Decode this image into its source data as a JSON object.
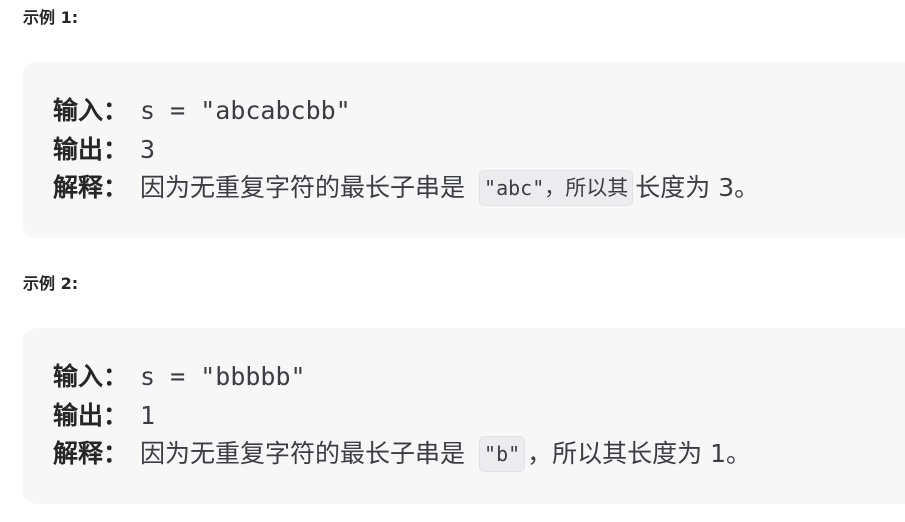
{
  "examples": [
    {
      "title": "示例 1:",
      "input_label": "输入：",
      "input_value": "s = \"abcabcbb\"",
      "output_label": "输出：",
      "output_value": "3",
      "explanation_label": "解释：",
      "explanation_prefix": "因为无重复字符的最长子串是",
      "explanation_code": "\"abc\"",
      "explanation_code_suffix": "，所以其",
      "explanation_suffix": "长度为 3。"
    },
    {
      "title": "示例 2:",
      "input_label": "输入：",
      "input_value": "s = \"bbbbb\"",
      "output_label": "输出：",
      "output_value": "1",
      "explanation_label": "解释：",
      "explanation_prefix": "因为无重复字符的最长子串是",
      "explanation_code": "\"b\"",
      "explanation_suffix": "，所以其长度为 1。"
    }
  ]
}
